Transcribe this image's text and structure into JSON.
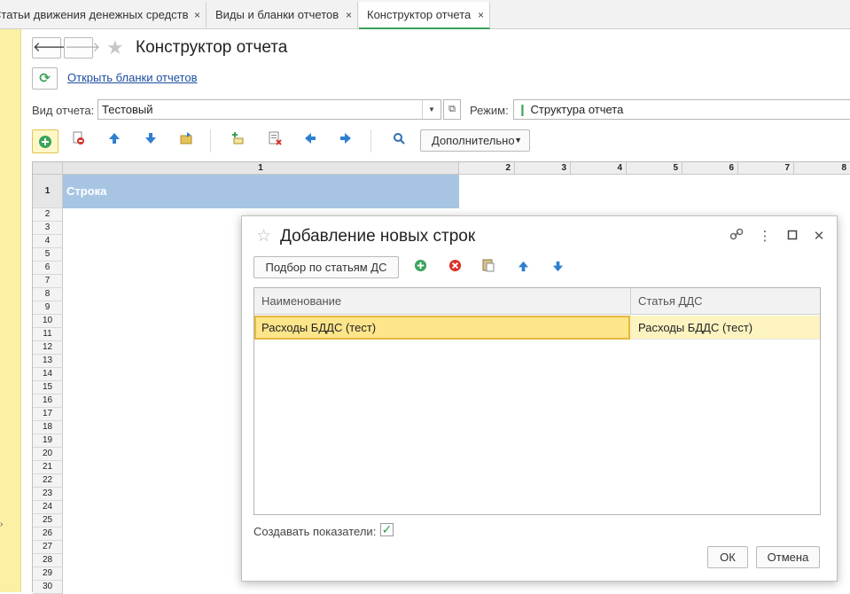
{
  "tabs": [
    {
      "label": "Статьи движения денежных средств",
      "close": "×",
      "active": false
    },
    {
      "label": "Виды и бланки отчетов",
      "close": "×",
      "active": false
    },
    {
      "label": "Конструктор отчета",
      "close": "×",
      "active": true
    }
  ],
  "header": {
    "title": "Конструктор отчета",
    "back_icon": "arrow-left-icon",
    "forward_icon": "arrow-right-icon",
    "favorite_icon": "star-icon",
    "refresh_icon": "refresh-icon",
    "link": "Открыть бланки отчетов"
  },
  "form": {
    "report_type_label": "Вид отчета:",
    "report_type_value": "Тестовый",
    "mode_label": "Режим:",
    "mode_value": "Структура отчета"
  },
  "toolbar": {
    "more_label": "Дополнительно"
  },
  "sheet": {
    "columns": [
      "1",
      "2",
      "3",
      "4",
      "5",
      "6",
      "7",
      "8"
    ],
    "rows": [
      "1",
      "2",
      "3",
      "4",
      "5",
      "6",
      "7",
      "8",
      "9",
      "10",
      "11",
      "12",
      "13",
      "14",
      "15",
      "16",
      "17",
      "18",
      "19",
      "20",
      "21",
      "22",
      "23",
      "24",
      "25",
      "26",
      "27",
      "28",
      "29",
      "30"
    ],
    "row1_cell": "Строка"
  },
  "dialog": {
    "title": "Добавление новых строк",
    "select_button": "Подбор по статьям ДС",
    "columns": [
      "Наименование",
      "Статья ДДС"
    ],
    "rows": [
      {
        "name": "Расходы БДДС (тест)",
        "article": "Расходы БДДС (тест)"
      }
    ],
    "create_indicators_label": "Создавать показатели:",
    "create_indicators_checked": true,
    "ok": "ОК",
    "cancel": "Отмена"
  },
  "colors": {
    "accent_green": "#3aa45a",
    "selection_yellow": "#fde58a",
    "row_blue": "#a7c5e3",
    "side_panel": "#fbf0a4"
  }
}
